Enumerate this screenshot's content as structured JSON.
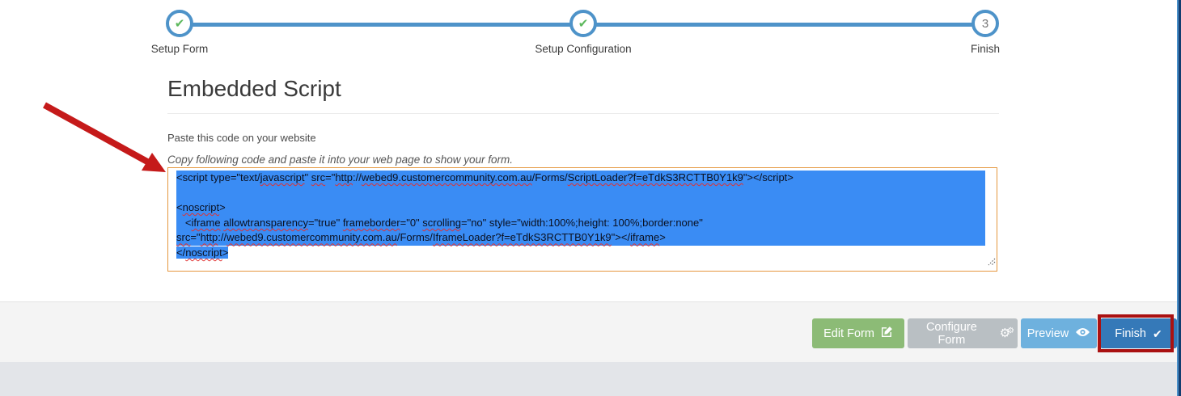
{
  "stepper": {
    "steps": [
      {
        "label": "Setup Form",
        "state": "complete"
      },
      {
        "label": "Setup Configuration",
        "state": "complete"
      },
      {
        "label": "Finish",
        "state": "current",
        "number": "3"
      }
    ],
    "check_glyph": "✔"
  },
  "content": {
    "title": "Embedded Script",
    "instruction": "Paste this code on your website",
    "hint": "Copy following code and paste it into your web page to show your form."
  },
  "code": {
    "selected_full_lines": 5,
    "lines": [
      [
        {
          "t": "<script type=\"text/"
        },
        {
          "t": "javascript",
          "sq": true
        },
        {
          "t": "\" "
        },
        {
          "t": "src",
          "sq": true
        },
        {
          "t": "=\""
        },
        {
          "t": "http",
          "sq": true
        },
        {
          "t": "://"
        },
        {
          "t": "webed9.customercommunity.com.au",
          "sq": true
        },
        {
          "t": "/Forms/"
        },
        {
          "t": "ScriptLoader?f=eTdkS3RCTTB0Y1k9",
          "sq": true
        },
        {
          "t": "\"></script>"
        }
      ],
      [],
      [
        {
          "t": "<"
        },
        {
          "t": "noscript",
          "sq": true
        },
        {
          "t": ">"
        }
      ],
      [
        {
          "t": "   <"
        },
        {
          "t": "iframe",
          "sq": true
        },
        {
          "t": " "
        },
        {
          "t": "allowtransparency",
          "sq": true
        },
        {
          "t": "=\"true\" "
        },
        {
          "t": "frameborder",
          "sq": true
        },
        {
          "t": "=\"0\" "
        },
        {
          "t": "scrolling",
          "sq": true
        },
        {
          "t": "=\"no\" style=\"width:100%;height: 100%;border:none\""
        }
      ],
      [
        {
          "t": "src",
          "sq": true
        },
        {
          "t": "=\""
        },
        {
          "t": "http",
          "sq": true
        },
        {
          "t": "://"
        },
        {
          "t": "webed9.customercommunity.com.au",
          "sq": true
        },
        {
          "t": "/Forms/"
        },
        {
          "t": "IframeLoader?f=eTdkS3RCTTB0Y1k9",
          "sq": true
        },
        {
          "t": "\"></"
        },
        {
          "t": "iframe",
          "sq": true
        },
        {
          "t": ">"
        }
      ],
      [
        {
          "t": "</"
        },
        {
          "t": "noscript",
          "sq": true
        },
        {
          "t": ">"
        }
      ]
    ]
  },
  "footer": {
    "buttons": [
      {
        "label": "Edit Form",
        "icon": "edit-icon"
      },
      {
        "label": "Configure Form",
        "icon": "gears-icon"
      },
      {
        "label": "Preview",
        "icon": "eye-icon"
      },
      {
        "label": "Finish",
        "icon": "check-icon",
        "annotated": true
      }
    ],
    "check_glyph": "✔",
    "gear_glyph": "⚙"
  },
  "colors": {
    "stepper_blue": "#4e93c9",
    "check_green": "#5cb85c",
    "selection_blue": "#3a8cf4",
    "textarea_border_orange": "#e5973e",
    "button_green": "#8cbb76",
    "button_gray": "#b9bfc3",
    "button_light_blue": "#6eb1de",
    "button_blue": "#3579b8",
    "annotation_red": "#aa1111"
  }
}
